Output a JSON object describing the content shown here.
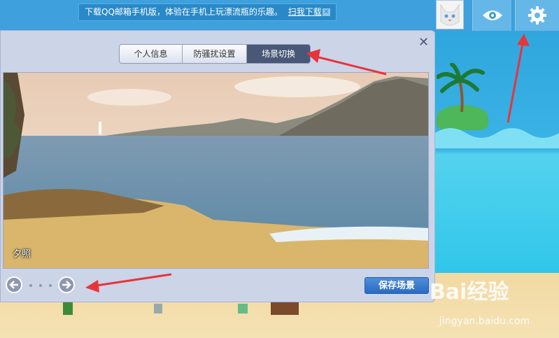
{
  "banner": {
    "text": "下载QQ邮箱手机版，体验在手机上玩漂流瓶的乐趣。",
    "link": "扫我下载",
    "close": "✕"
  },
  "dialog": {
    "close": "✕",
    "tabs": [
      {
        "label": "个人信息",
        "active": false
      },
      {
        "label": "防骚扰设置",
        "active": false
      },
      {
        "label": "场景切换",
        "active": true
      }
    ],
    "scene_name": "夕照",
    "save_label": "保存场景",
    "pager": {
      "pages": 3,
      "current": 1
    }
  },
  "watermark": {
    "brand": "Bai经验",
    "url": "jingyan.baidu.com"
  },
  "colors": {
    "accent": "#4a5878",
    "save": "#2a6ac2",
    "annotation": "#e8343b"
  }
}
